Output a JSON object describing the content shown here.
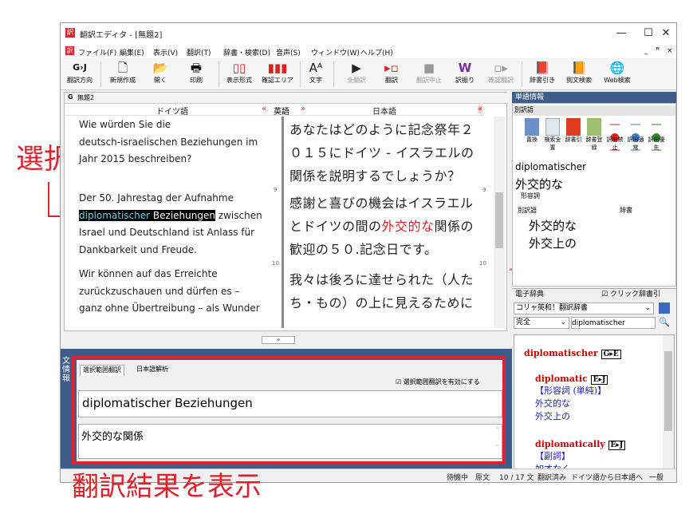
{
  "window": {
    "title": "翻訳エディタ - [無題2]",
    "minimize": "—",
    "maximize": "☐",
    "close": "✕",
    "mdi_min": "_",
    "mdi_restore": "ꟸ",
    "mdi_close": "×"
  },
  "menu": [
    "ファイル(F)",
    "編集(E)",
    "表示(V)",
    "翻訳(T)",
    "辞書・検索(D)",
    "音声(S)",
    "ウィンドウ(W)",
    "ヘルプ(H)"
  ],
  "toolbar": [
    {
      "label": "翻訳方向",
      "icon": "G›J"
    },
    {
      "label": "新規作成",
      "icon": "🗋"
    },
    {
      "label": "開く",
      "icon": "📂"
    },
    {
      "label": "印刷",
      "icon": "🖶"
    },
    {
      "label": "表示形式",
      "icon": "▯▯"
    },
    {
      "label": "確認エリア",
      "icon": "▮▮▮"
    },
    {
      "label": "文字",
      "icon": "Aᴬ"
    },
    {
      "label": "全翻訳",
      "icon": "▶"
    },
    {
      "label": "翻訳",
      "icon": "▸▫"
    },
    {
      "label": "翻訳中止",
      "icon": "■"
    },
    {
      "label": "訳振り",
      "icon": "W"
    },
    {
      "label": "確認翻訳",
      "icon": "▫▸"
    },
    {
      "label": "辞書引き",
      "icon": "📕"
    },
    {
      "label": "例文検索",
      "icon": "📙"
    },
    {
      "label": "Web検索",
      "icon": "🌐"
    }
  ],
  "document": {
    "tab": "無題2",
    "tab_icon": "G",
    "source_header": "ドイツ語",
    "middle_header": "英語",
    "target_header": "日本語",
    "german": {
      "s1": [
        "Wie würden Sie die",
        "deutsch-israelischen Beziehungen im",
        "Jahr 2015 beschreiben?"
      ],
      "s2_l1": "Der 50. Jahrestag der Aufnahme",
      "s2_hl_a": "diplomatischer",
      "s2_hl_b": " Beziehungen",
      "s2_l2_rest": " zwischen",
      "s2_l3": "Israel und Deutschland ist Anlass für",
      "s2_l4": "Dankbarkeit und Freude.",
      "s3": [
        "Wir können auf das Erreichte",
        "zurückzuschauen und dürfen es –",
        "ganz ohne Übertreibung – als Wunder"
      ]
    },
    "japanese": {
      "s1": [
        "あなたはどのように記念祭年２",
        "０１５にドイツ - イスラエルの",
        "関係を説明するでしょうか？"
      ],
      "s2_l1": "感謝と喜びの機会はイスラエル",
      "s2_l2_pre": "とドイツの間の",
      "s2_l2_red": "外交的な",
      "s2_l2_post": "関係の",
      "s2_l3": "歓迎の５０.記念日です。",
      "s3": [
        "我々は後ろに達せられた（人た",
        "ち・もの）の上に見えるために"
      ]
    },
    "nums": [
      "9",
      "10"
    ]
  },
  "word_info": {
    "title": "単語情報",
    "sub": "別訳語",
    "buttons": [
      "置換",
      "検索全置",
      "辞書引",
      "辞書登録",
      "訳出禁止",
      "訳出通常",
      "訳出優先"
    ],
    "word": "diplomatischer",
    "translation": "外交的な",
    "pos": "形容詞",
    "col_alt": "別訳語",
    "col_dict": "辞書",
    "alts": [
      "外交的な",
      "外交上の"
    ]
  },
  "edict": {
    "title": "電子辞典",
    "click_label": "クリック辞書引",
    "dict_name": "コリャ英和！翻訳辞書",
    "mode": "完全",
    "search": "diplomatischer",
    "entries": [
      {
        "head": "diplomatischer",
        "tag": "G▸E",
        "lines": []
      },
      {
        "head": "diplomatic",
        "tag": "E▸J",
        "lines": [
          "【形容詞 (単純)】",
          "外交的な",
          "外交上の"
        ]
      },
      {
        "head": "diplomatically",
        "tag": "E▸J",
        "lines": [
          "【副詞】",
          "如才なく"
        ]
      }
    ]
  },
  "bottom": {
    "side_label": "文情報",
    "tabs": [
      "選択範囲翻訳",
      "日本語解析"
    ],
    "checkbox_label": "選択範囲翻訳を有効にする",
    "source_text": "diplomatischer Beziehungen",
    "result_text": "外交的な関係"
  },
  "status": [
    "待機中",
    "原文",
    "10 / 17 文",
    "翻訳済み",
    "ドイツ語から日本語へ",
    "一般"
  ],
  "annotations": {
    "selection": "選択範囲",
    "result": "翻訳結果を表示"
  },
  "colors": {
    "panel_blue": "#3d5d8c",
    "annotation_red": "#e0202a"
  }
}
